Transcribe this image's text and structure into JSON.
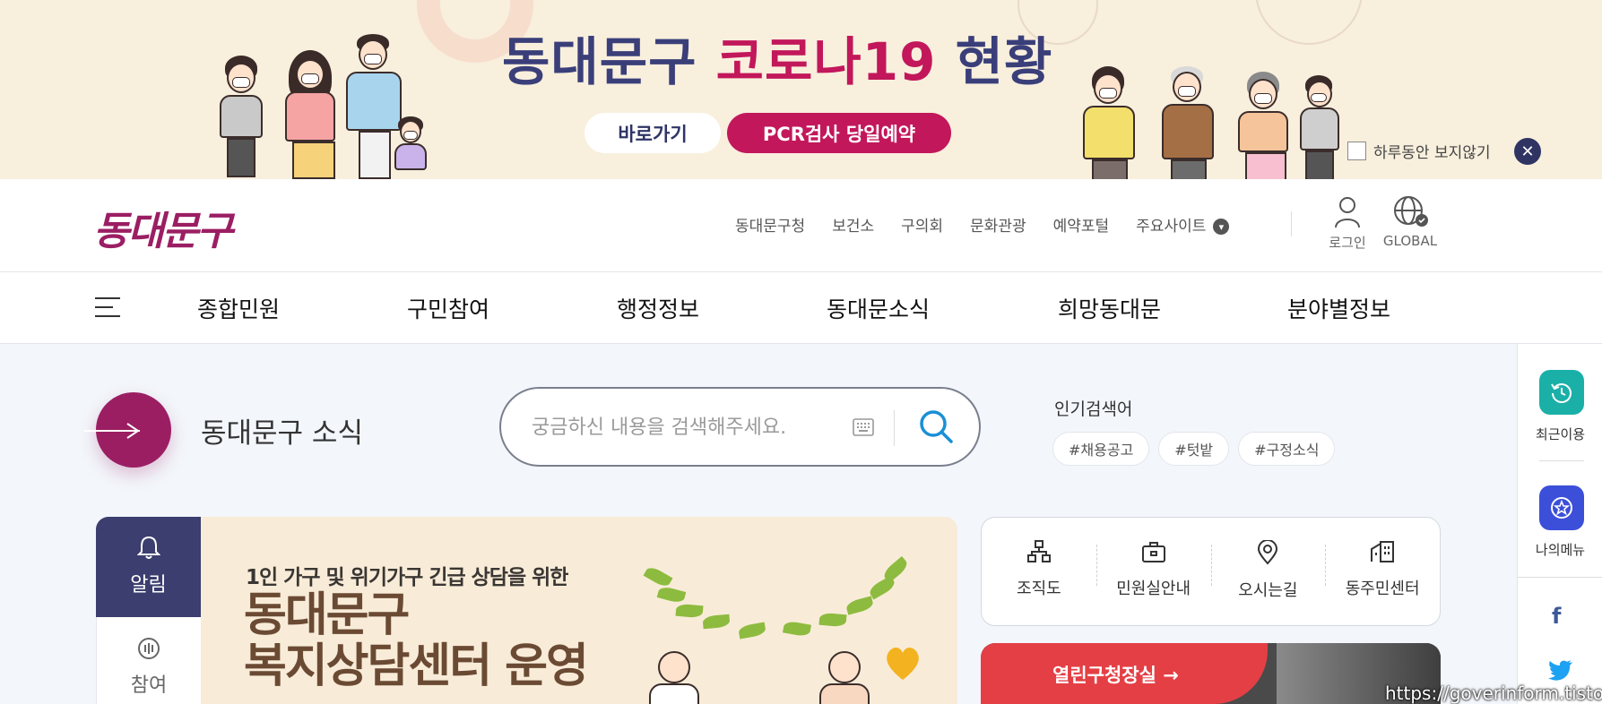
{
  "banner": {
    "title_part1": "동대문구",
    "title_part2": "코로나19",
    "title_part3": "현황",
    "go_button": "바로가기",
    "pcr_button": "PCR검사 당일예약",
    "hide_today": "하루동안 보지않기",
    "close": "✕"
  },
  "header": {
    "logo": "동대문구",
    "util_links": [
      "동대문구청",
      "보건소",
      "구의회",
      "문화관광",
      "예약포털",
      "주요사이트"
    ],
    "login": "로그인",
    "global": "GLOBAL"
  },
  "nav": {
    "items": [
      "종합민원",
      "구민참여",
      "행정정보",
      "동대문소식",
      "희망동대문",
      "분야별정보"
    ]
  },
  "main": {
    "section_title": "동대문구 소식",
    "search_placeholder": "궁금하신 내용을 검색해주세요.",
    "popular_label": "인기검색어",
    "tags": [
      "#채용공고",
      "#텃밭",
      "#구정소식"
    ]
  },
  "notice": {
    "tab_alarm": "알림",
    "tab_join": "참여",
    "banner_sub": "1인 가구 및 위기가구 긴급 상담을 위한",
    "banner_main_line1": "동대문구",
    "banner_main_line2": "복지상담센터 운영"
  },
  "quick": {
    "items": [
      "조직도",
      "민원실안내",
      "오시는길",
      "동주민센터"
    ]
  },
  "open_office": {
    "label": "열린구청장실 →"
  },
  "side": {
    "recent": "최근이용",
    "my_menu": "나의메뉴"
  },
  "watermark": "https://goverinform.tistory",
  "colors": {
    "brand": "#9b1e63",
    "navy": "#3b3e6e",
    "pcr": "#c2175b",
    "teal": "#1ab0a8",
    "blue": "#3b4fd8",
    "red": "#e43f45"
  }
}
